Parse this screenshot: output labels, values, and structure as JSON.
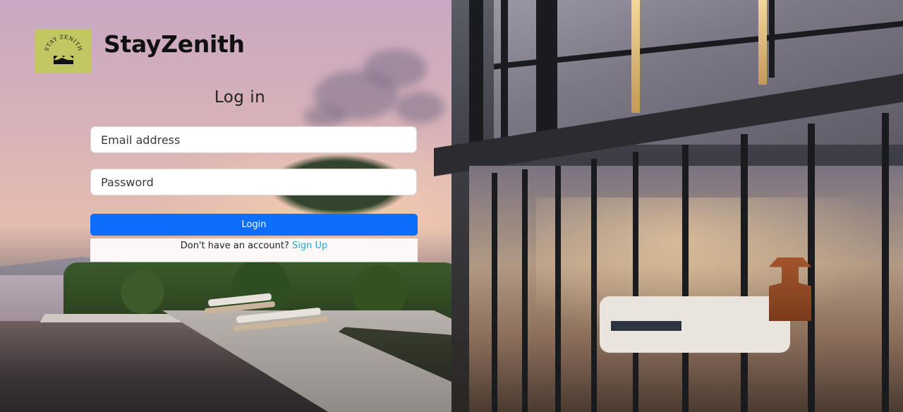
{
  "brand": {
    "name": "StayZenith",
    "logo_text": "STAY ZENITH",
    "logo_color": "#c3c763"
  },
  "login_form": {
    "title": "Log in",
    "email_placeholder": "Email address",
    "password_placeholder": "Password",
    "submit_label": "Login",
    "submit_color": "#0d6efd",
    "signup_prompt": "Don't have an account?",
    "signup_link": "Sign Up",
    "link_color": "#2aa5c9"
  }
}
